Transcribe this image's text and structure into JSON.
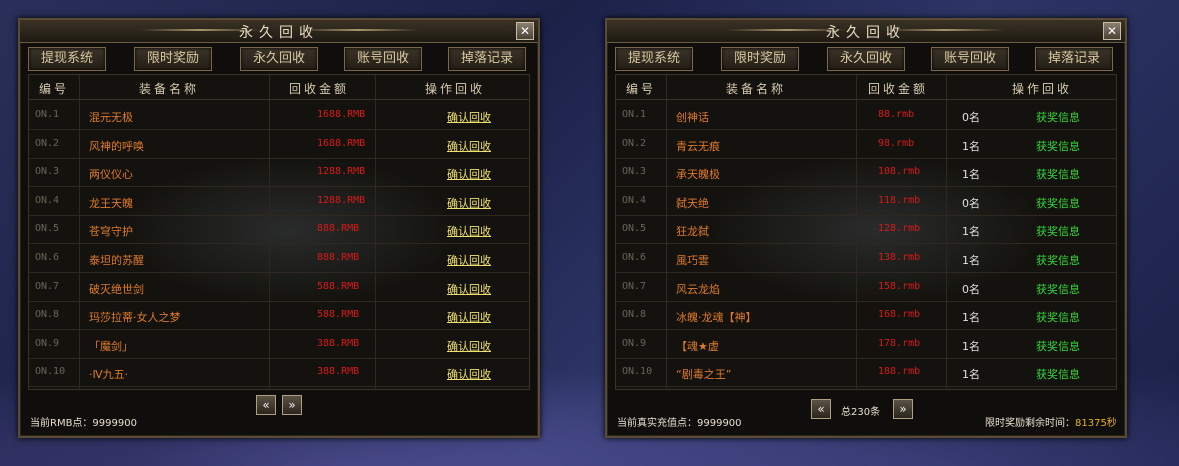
{
  "colors": {
    "name": "#e07a2a",
    "amount": "#d81a1a",
    "confirm": "#f0e070",
    "award": "#38d838"
  },
  "left": {
    "title": "永久回收",
    "tabs": [
      "提现系统",
      "限时奖励",
      "永久回收",
      "账号回收",
      "掉落记录"
    ],
    "headers": {
      "no": "编号",
      "name": "装备名称",
      "amount": "回收金额",
      "action": "操作回收"
    },
    "rows": [
      {
        "no": "ON.1",
        "name": "混元无极",
        "amount": "1688.RMB",
        "action": "确认回收"
      },
      {
        "no": "ON.2",
        "name": "风神的呼唤",
        "amount": "1688.RMB",
        "action": "确认回收"
      },
      {
        "no": "ON.3",
        "name": "两仪仪心",
        "amount": "1288.RMB",
        "action": "确认回收"
      },
      {
        "no": "ON.4",
        "name": "龙王天魄",
        "amount": "1288.RMB",
        "action": "确认回收"
      },
      {
        "no": "ON.5",
        "name": "苍穹守护",
        "amount": "888.RMB",
        "action": "确认回收"
      },
      {
        "no": "ON.6",
        "name": "泰坦的苏醒",
        "amount": "888.RMB",
        "action": "确认回收"
      },
      {
        "no": "ON.7",
        "name": "破灭绝世剑",
        "amount": "588.RMB",
        "action": "确认回收"
      },
      {
        "no": "ON.8",
        "name": "玛莎拉蒂·女人之梦",
        "amount": "588.RMB",
        "action": "确认回收"
      },
      {
        "no": "ON.9",
        "name": "「魔剑」",
        "amount": "388.RMB",
        "action": "确认回收"
      },
      {
        "no": "ON.10",
        "name": "·Ⅳ九五·",
        "amount": "388.RMB",
        "action": "确认回收"
      }
    ],
    "footer": "当前RMB点：9999900"
  },
  "right": {
    "title": "永久回收",
    "tabs": [
      "提现系统",
      "限时奖励",
      "永久回收",
      "账号回收",
      "掉落记录"
    ],
    "headers": {
      "no": "编号",
      "name": "装备名称",
      "amount": "回收金额",
      "action": "操作回收"
    },
    "rows": [
      {
        "no": "ON.1",
        "name": "创神话",
        "amount": "88.rmb",
        "count": "0名",
        "action": "获奖信息"
      },
      {
        "no": "ON.2",
        "name": "青云无痕",
        "amount": "98.rmb",
        "count": "1名",
        "action": "获奖信息"
      },
      {
        "no": "ON.3",
        "name": "承天魄极",
        "amount": "108.rmb",
        "count": "1名",
        "action": "获奖信息"
      },
      {
        "no": "ON.4",
        "name": "弑天绝",
        "amount": "118.rmb",
        "count": "0名",
        "action": "获奖信息"
      },
      {
        "no": "ON.5",
        "name": "狂龙弑",
        "amount": "128.rmb",
        "count": "1名",
        "action": "获奖信息"
      },
      {
        "no": "ON.6",
        "name": "風巧雲",
        "amount": "138.rmb",
        "count": "1名",
        "action": "获奖信息"
      },
      {
        "no": "ON.7",
        "name": "风云龙焰",
        "amount": "158.rmb",
        "count": "0名",
        "action": "获奖信息"
      },
      {
        "no": "ON.8",
        "name": "冰魄·龙魂【神】",
        "amount": "168.rmb",
        "count": "1名",
        "action": "获奖信息"
      },
      {
        "no": "ON.9",
        "name": "【魂★虚",
        "amount": "178.rmb",
        "count": "1名",
        "action": "获奖信息"
      },
      {
        "no": "ON.10",
        "name": "“剧毒之王”",
        "amount": "188.rmb",
        "count": "1名",
        "action": "获奖信息"
      }
    ],
    "total": "总230条",
    "footer_left": "当前真实充值点：9999900",
    "footer_right_label": "限时奖励剩余时间：",
    "footer_right_value": "81375秒"
  }
}
